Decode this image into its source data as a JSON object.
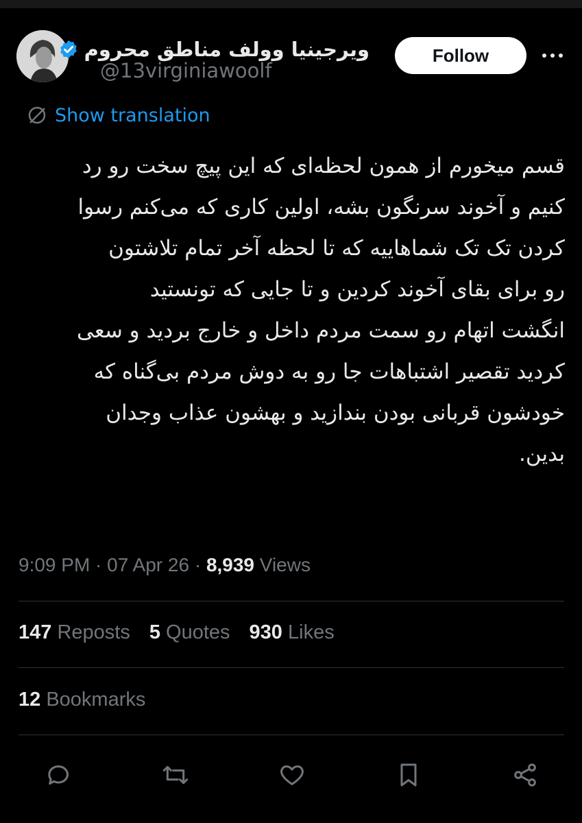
{
  "user": {
    "display_name": "ویرجینیا وولف مناطق محروم",
    "handle": "@13virginiawoolf",
    "verified": true
  },
  "follow_label": "Follow",
  "translation_label": "Show translation",
  "tweet": {
    "lines": [
      "قسم میخورم از همون لحظه‌ای که این پیچ سخت رو رد",
      "کنیم و آخوند سرنگون بشه، اولین کاری که می‌کنم رسوا",
      "کردن تک تک شماهاییه که تا لحظه آخر تمام تلاشتون",
      "رو برای بقای آخوند کردین و تا جایی که تونستید",
      "انگشت اتهام رو سمت مردم داخل و خارج بردید و سعی",
      "کردید تقصیر اشتباهات جا رو به دوش مردم بی‌گناه که",
      "خودشون قربانی بودن بندازید و بهشون عذاب وجدان",
      "بدین."
    ]
  },
  "meta": {
    "time": "9:09 PM",
    "sep1": " · ",
    "date": "07 Apr 26",
    "sep2": " · ",
    "views_count": "8,939",
    "views_label": " Views"
  },
  "stats": {
    "reposts_count": "147",
    "reposts_label": " Reposts",
    "quotes_count": "5",
    "quotes_label": " Quotes",
    "likes_count": "930",
    "likes_label": " Likes",
    "bookmarks_count": "12",
    "bookmarks_label": " Bookmarks"
  },
  "colors": {
    "background": "#000000",
    "accent": "#1d9bf0",
    "text": "#e7e9ea",
    "muted": "#71767b"
  },
  "icons": [
    "verified-badge-icon",
    "more-icon",
    "globe-icon",
    "reply-icon",
    "repost-icon",
    "like-icon",
    "bookmark-icon",
    "share-icon"
  ]
}
